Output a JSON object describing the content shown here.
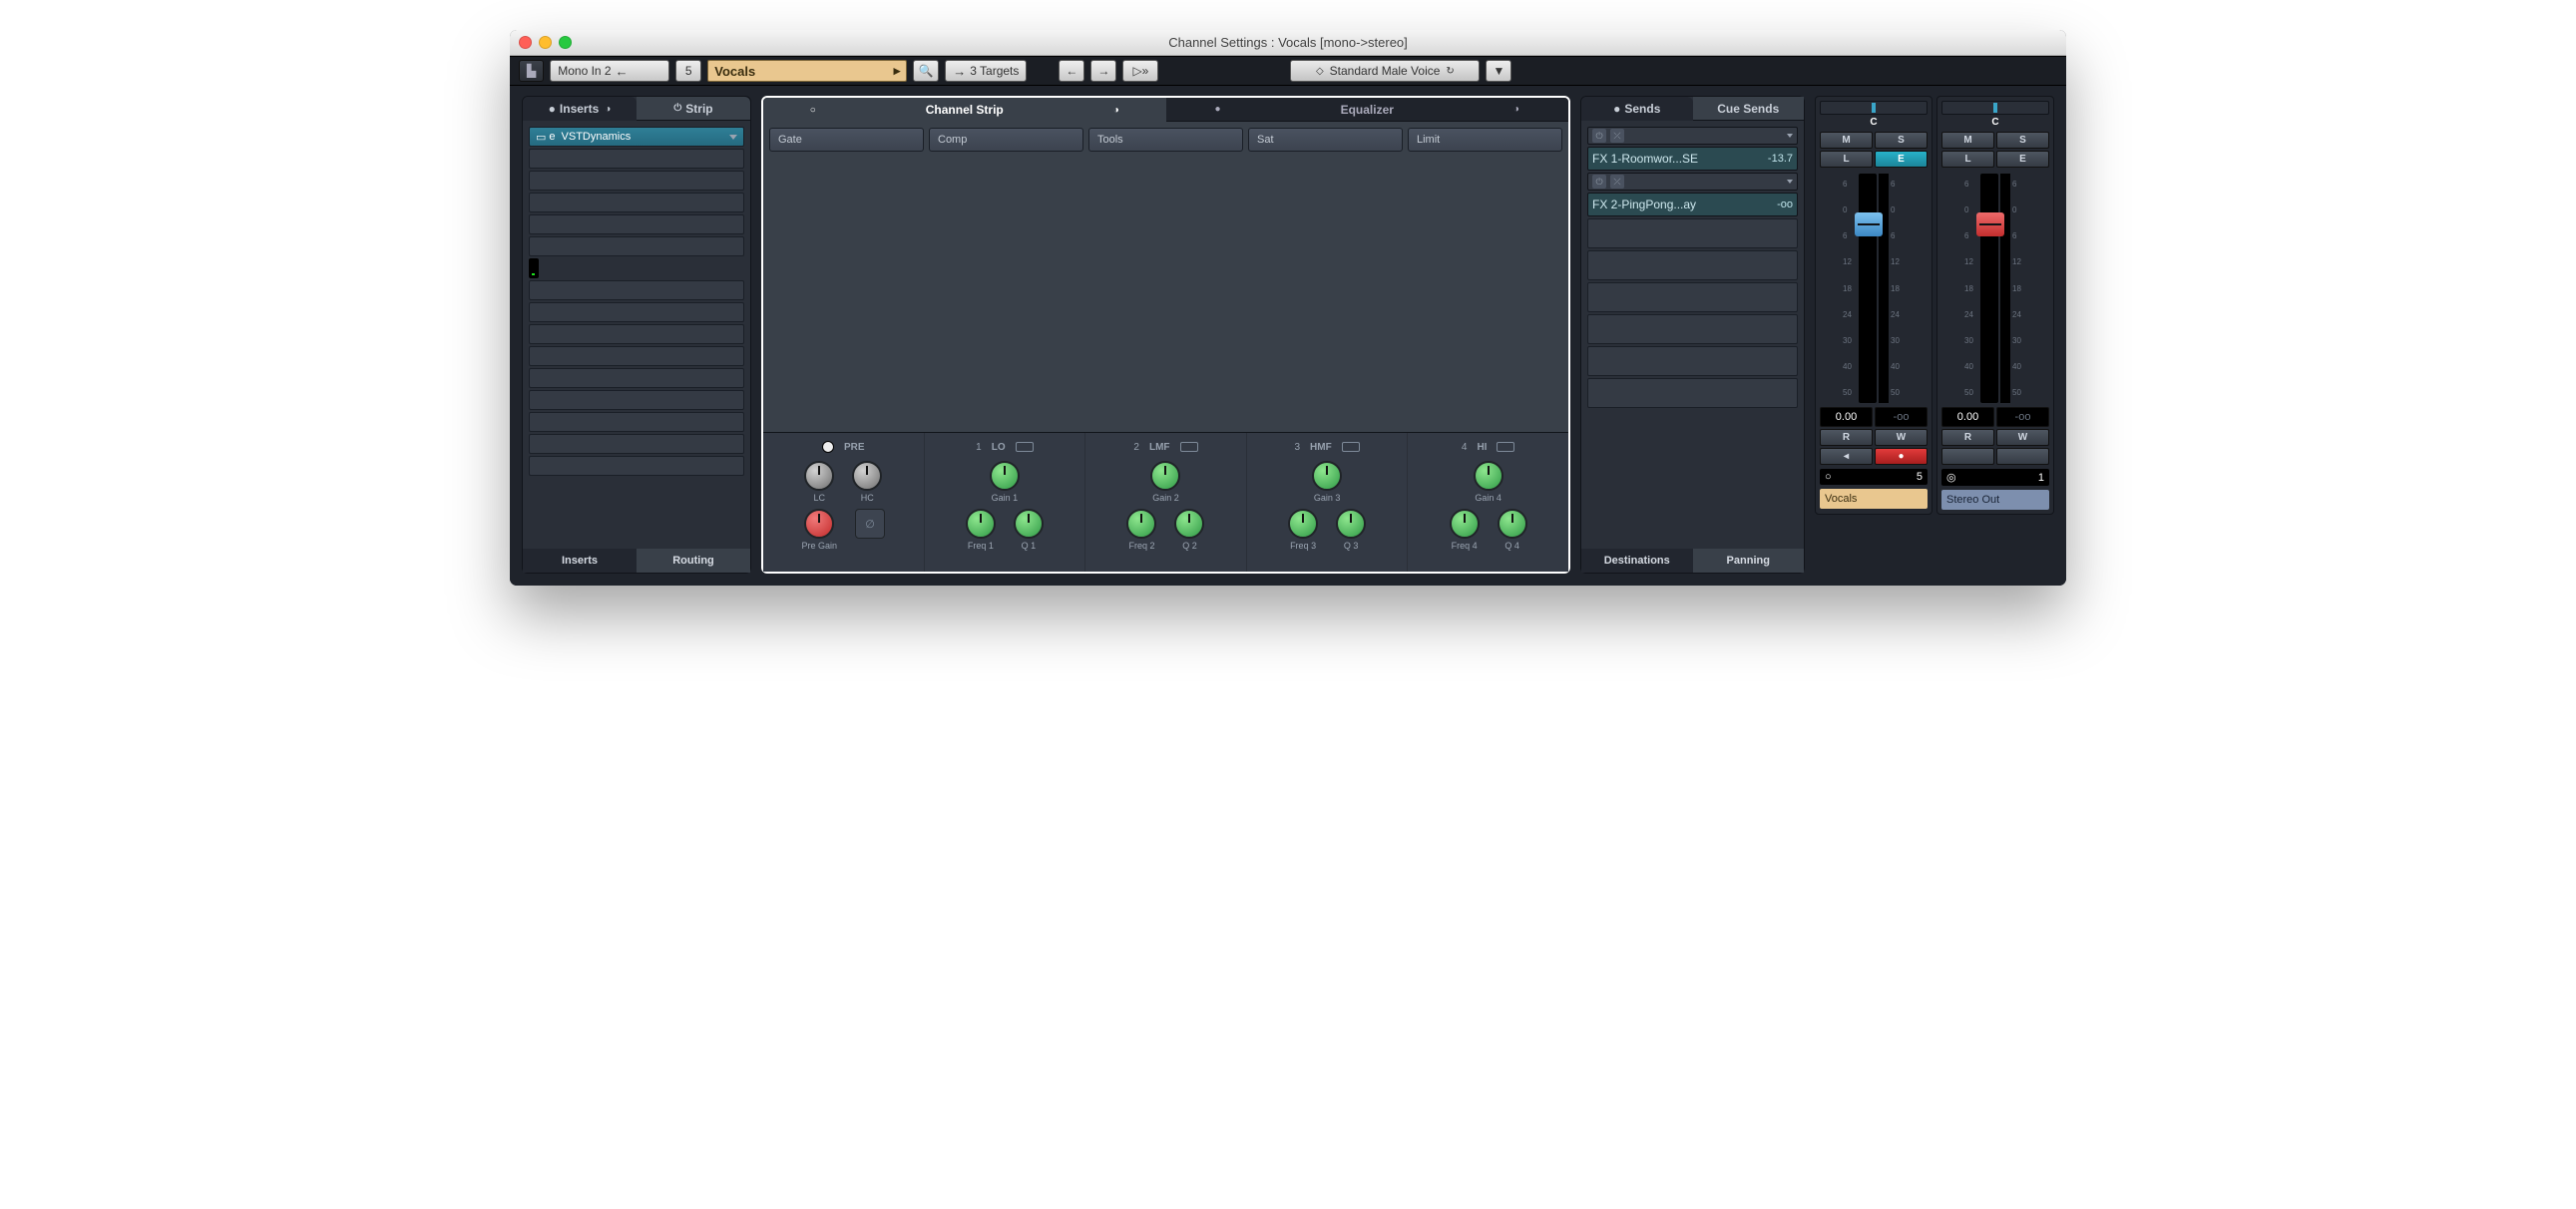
{
  "window": {
    "title": "Channel Settings : Vocals [mono->stereo]"
  },
  "toolbar": {
    "input": "Mono In 2",
    "channel_number": "5",
    "channel_name": "Vocals",
    "targets": "3 Targets",
    "preset": "Standard Male Voice"
  },
  "left": {
    "tab_inserts": "Inserts",
    "tab_strip": "Strip",
    "insert1": "VSTDynamics",
    "bottom_a": "Inserts",
    "bottom_b": "Routing"
  },
  "center": {
    "tab_strip": "Channel Strip",
    "tab_eq": "Equalizer",
    "modules": {
      "gate": "Gate",
      "comp": "Comp",
      "tools": "Tools",
      "sat": "Sat",
      "limit": "Limit"
    },
    "pre": {
      "header": "PRE",
      "lc": "LC",
      "hc": "HC",
      "pregain": "Pre Gain"
    },
    "bands": [
      {
        "num": "1",
        "name": "LO",
        "gain": "Gain 1",
        "freq": "Freq 1",
        "q": "Q 1"
      },
      {
        "num": "2",
        "name": "LMF",
        "gain": "Gain 2",
        "freq": "Freq 2",
        "q": "Q 2"
      },
      {
        "num": "3",
        "name": "HMF",
        "gain": "Gain 3",
        "freq": "Freq 3",
        "q": "Q 3"
      },
      {
        "num": "4",
        "name": "HI",
        "gain": "Gain 4",
        "freq": "Freq 4",
        "q": "Q 4"
      }
    ]
  },
  "sends_panel": {
    "tab_sends": "Sends",
    "tab_cue": "Cue Sends",
    "items": [
      {
        "name": "FX 1-Roomwor...SE",
        "value": "-13.7"
      },
      {
        "name": "FX 2-PingPong...ay",
        "value": "-oo"
      }
    ],
    "bottom_a": "Destinations",
    "bottom_b": "Panning"
  },
  "fader": {
    "pan_label": "C",
    "btn_m": "M",
    "btn_s": "S",
    "btn_l": "L",
    "btn_e": "E",
    "btn_r": "R",
    "btn_w": "W",
    "scale": [
      "6",
      "0",
      "6",
      "12",
      "18",
      "24",
      "30",
      "40",
      "50"
    ],
    "vol_a": "0.00",
    "peak_a": "-oo",
    "vol_b": "0.00",
    "peak_b": "-oo",
    "idx_a": "5",
    "idx_b": "1",
    "name_a": "Vocals",
    "name_b": "Stereo Out"
  }
}
